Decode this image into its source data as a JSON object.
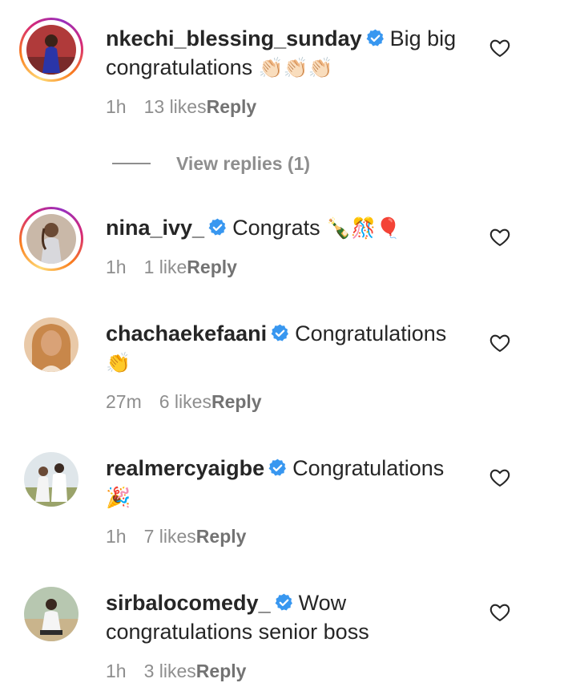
{
  "comments": [
    {
      "username": "nkechi_blessing_sunday",
      "text": "Big big congratulations",
      "emoji": "👏🏻👏🏻👏🏻",
      "time": "1h",
      "likes": "13 likes",
      "reply_label": "Reply",
      "story_ring": true
    },
    {
      "username": "nina_ivy_",
      "text": "Congrats",
      "emoji": "🍾🎊🎈",
      "time": "1h",
      "likes": "1 like",
      "reply_label": "Reply",
      "story_ring": true
    },
    {
      "username": "chachaekefaani",
      "text": "Congratulations",
      "emoji": "👏",
      "time": "27m",
      "likes": "6 likes",
      "reply_label": "Reply",
      "story_ring": false
    },
    {
      "username": "realmercyaigbe",
      "text": "Congratulations",
      "emoji": "🎉",
      "time": "1h",
      "likes": "7 likes",
      "reply_label": "Reply",
      "story_ring": false
    },
    {
      "username": "sirbalocomedy_",
      "text": "Wow congratulations senior boss",
      "emoji": "",
      "time": "1h",
      "likes": "3 likes",
      "reply_label": "Reply",
      "story_ring": false
    }
  ],
  "view_replies": "View replies (1)",
  "colors": {
    "verified": "#3897f0",
    "meta": "#8e8e8e",
    "text": "#262626"
  }
}
